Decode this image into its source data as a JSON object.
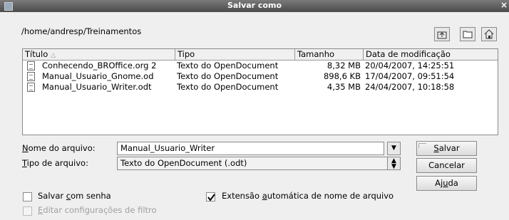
{
  "window": {
    "title": "Salvar como",
    "close_glyph": "×"
  },
  "path": "/home/andresp/Treinamentos",
  "toolbar": {
    "icons": [
      "go-up-folder-icon",
      "new-folder-icon",
      "home-folder-icon"
    ]
  },
  "file_list": {
    "columns": [
      "Título",
      "Tipo",
      "Tamanho",
      "Data de modificação"
    ],
    "sort_glyph": "△",
    "rows": [
      {
        "name": "Conhecendo_BROffice.org 2",
        "type": "Texto do OpenDocument",
        "size": "8,32 MB",
        "date": "20/04/2007, 14:25:51"
      },
      {
        "name": "Manual_Usuario_Gnome.od",
        "type": "Texto do OpenDocument",
        "size": "898,6 KB",
        "date": "17/04/2007, 09:51:54"
      },
      {
        "name": "Manual_Usuario_Writer.odt",
        "type": "Texto do OpenDocument",
        "size": "4,35 MB",
        "date": "24/04/2007, 10:18:58"
      }
    ]
  },
  "filename": {
    "label_u": "N",
    "label_rest": "ome do arquivo:",
    "value": "Manual_Usuario_Writer"
  },
  "filetype": {
    "label_u": "T",
    "label_rest": "ipo de arquivo:",
    "value": "Texto do OpenDocument (.odt)"
  },
  "buttons": {
    "save_u": "S",
    "save_rest": "alvar",
    "cancel": "Cancelar",
    "help_pre": "Aj",
    "help_u": "u",
    "help_rest": "da"
  },
  "options": {
    "password_pre": "Salvar ",
    "password_u": "c",
    "password_rest": "om senha",
    "password_checked": false,
    "extension_pre": "Extensão ",
    "extension_u": "a",
    "extension_rest": "utomática de nome de arquivo",
    "extension_checked": true,
    "filter_u": "E",
    "filter_rest": "ditar configurações de filtro",
    "filter_enabled": false
  }
}
